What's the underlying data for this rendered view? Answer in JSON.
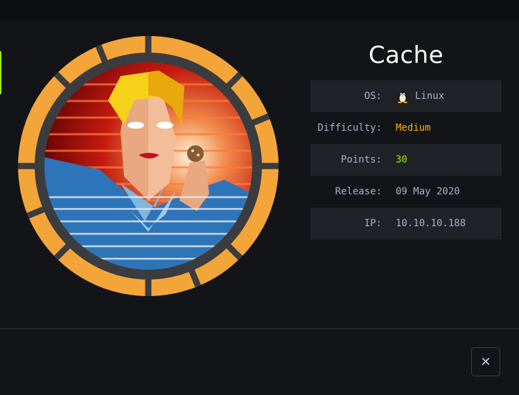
{
  "machine": {
    "name": "Cache",
    "avatar_icon": "cache-machine-avatar"
  },
  "info": {
    "os_label": "OS:",
    "os_value": "Linux",
    "os_icon": "linux-tux-icon",
    "difficulty_label": "Difficulty:",
    "difficulty_value": "Medium",
    "points_label": "Points:",
    "points_value": "30",
    "release_label": "Release:",
    "release_value": "09 May 2020",
    "ip_label": "IP:",
    "ip_value": "10.10.10.188"
  },
  "actions": {
    "close_label": "✕",
    "close_icon": "close-icon"
  },
  "colors": {
    "accent_green": "#9fef00",
    "difficulty_orange": "#ffaf00",
    "ring_orange": "#f4a53a",
    "text_muted": "#a4b1cd"
  }
}
